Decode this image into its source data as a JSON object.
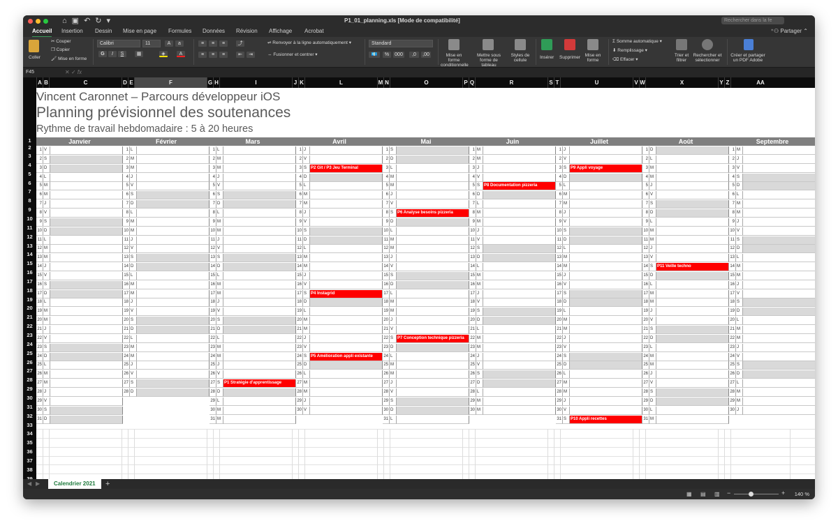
{
  "window": {
    "title": "P1_01_planning.xls  [Mode de compatibilité]",
    "search_placeholder": "Rechercher dans la fe"
  },
  "ribbon_tabs": [
    "Accueil",
    "Insertion",
    "Dessin",
    "Mise en page",
    "Formules",
    "Données",
    "Révision",
    "Affichage",
    "Acrobat"
  ],
  "share_label": "Partager",
  "ribbon": {
    "paste": "Coller",
    "cut": "Couper",
    "copy": "Copier",
    "format_painter": "Mise en forme",
    "font": "Calibri",
    "font_size": "11",
    "wrap": "Renvoyer à la ligne automatiquement",
    "merge": "Fusionner et centrer",
    "number_format": "Standard",
    "cond_format": "Mise en forme conditionnelle",
    "table_format": "Mettre sous forme de tableau",
    "cell_styles": "Styles de cellule",
    "insert": "Insérer",
    "delete": "Supprimer",
    "format": "Mise en forme",
    "autosum": "Somme automatique",
    "fill": "Remplissage",
    "clear": "Effacer",
    "sort": "Trier et filtrer",
    "find": "Rechercher et sélectionner",
    "pdf": "Créer et partager un PDF Adobe"
  },
  "name_box": "F45",
  "columns": [
    "A",
    "B",
    "C",
    "D",
    "E",
    "F",
    "G",
    "H",
    "I",
    "J",
    "K",
    "L",
    "M",
    "N",
    "O",
    "P",
    "Q",
    "R",
    "S",
    "T",
    "U",
    "V",
    "W",
    "X",
    "Y",
    "Z",
    "AA"
  ],
  "rows": [
    "1",
    "2",
    "3",
    "4",
    "5",
    "6",
    "7",
    "8",
    "9",
    "10",
    "11",
    "12",
    "13",
    "14",
    "15",
    "16",
    "17",
    "18",
    "19",
    "20",
    "21",
    "22",
    "23",
    "24",
    "25",
    "26",
    "27",
    "28",
    "29",
    "30",
    "31",
    "32",
    "33",
    "34",
    "35",
    "36",
    "37",
    "38",
    "39",
    "40"
  ],
  "header": {
    "line1": "Vincent Caronnet – Parcours développeur iOS",
    "line2": "Planning prévisionnel des soutenances",
    "line3": "Rythme de travail hebdomadaire : 5 à 20 heures"
  },
  "months": [
    {
      "name": "Janvier",
      "days": 31,
      "first": "V"
    },
    {
      "name": "Février",
      "days": 28,
      "first": "L"
    },
    {
      "name": "Mars",
      "days": 31,
      "first": "L"
    },
    {
      "name": "Avril",
      "days": 30,
      "first": "J"
    },
    {
      "name": "Mai",
      "days": 31,
      "first": "S"
    },
    {
      "name": "Juin",
      "days": 30,
      "first": "M"
    },
    {
      "name": "Juillet",
      "days": 31,
      "first": "J"
    },
    {
      "name": "Août",
      "days": 31,
      "first": "D"
    },
    {
      "name": "Septembre",
      "days": 30,
      "first": "M"
    }
  ],
  "day_letters": [
    "L",
    "M",
    "M",
    "J",
    "V",
    "S",
    "D"
  ],
  "events": [
    {
      "month": 3,
      "day": 3,
      "label": "P2 Git / P3 Jeu Terminal"
    },
    {
      "month": 3,
      "day": 17,
      "label": "P4 Instagrid"
    },
    {
      "month": 3,
      "day": 24,
      "label": "P5 Amélioration appli existante"
    },
    {
      "month": 2,
      "day": 27,
      "label": "P1 Stratégie d'apprentissage"
    },
    {
      "month": 4,
      "day": 8,
      "label": "P6 Analyse besoins pizzeria"
    },
    {
      "month": 4,
      "day": 22,
      "label": "P7 Conception technique pizzeria"
    },
    {
      "month": 5,
      "day": 5,
      "label": "P8 Documentation pizzeria"
    },
    {
      "month": 6,
      "day": 3,
      "label": "P9 Appli voyage"
    },
    {
      "month": 6,
      "day": 31,
      "label": "P10 Appli recettes"
    },
    {
      "month": 7,
      "day": 14,
      "label": "P11 Veille techno"
    }
  ],
  "sheet_tab": "Calendrier 2021",
  "zoom": "140 %"
}
